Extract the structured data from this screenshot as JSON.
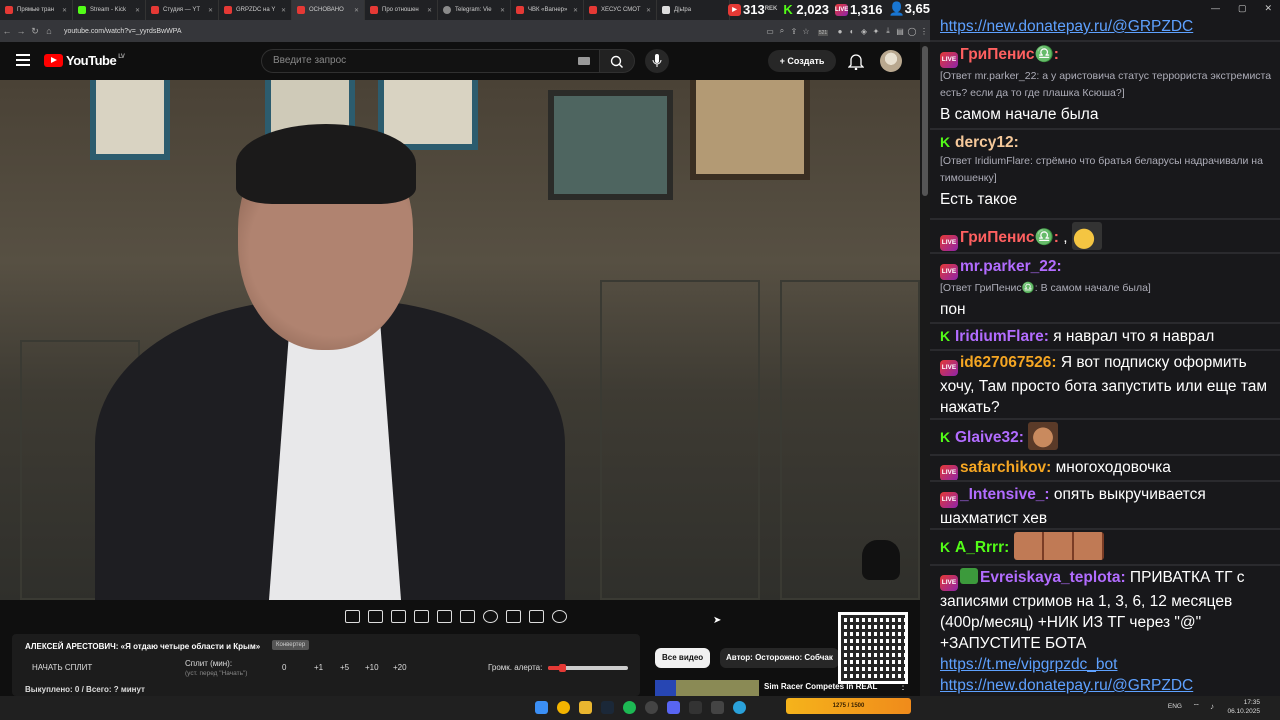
{
  "browser": {
    "tabs": [
      {
        "label": "Прямые тран",
        "color": "#e53935"
      },
      {
        "label": "Stream - Kick",
        "color": "#53fc18"
      },
      {
        "label": "Студия — YT",
        "color": "#e53935"
      },
      {
        "label": "GRPZDC на Y",
        "color": "#e53935"
      },
      {
        "label": "ОСНОВАНО",
        "color": "#e53935"
      },
      {
        "label": "Про отношен",
        "color": "#e53935"
      },
      {
        "label": "Telegram: Vie",
        "color": "#8a8a8a"
      },
      {
        "label": "ЧВК «Вагнер»",
        "color": "#e53935"
      },
      {
        "label": "ХЕСУС СМОТ",
        "color": "#e53935"
      },
      {
        "label": "Д|ьtра",
        "color": "#dddddd"
      }
    ],
    "url": "youtube.com/watch?v=_yyrdsBwWPA",
    "ext_badge": "521"
  },
  "stats": {
    "youtube": "313",
    "kick": "2,023",
    "live": "1,316",
    "viewers": "3,652",
    "partial_label": "REK"
  },
  "youtube": {
    "logo": "YouTube",
    "country": "LV",
    "search_placeholder": "Введите запрос",
    "create_label": "Создать"
  },
  "panel": {
    "title": "АЛЕКСЕЙ АРЕСТОВИЧ: «Я отдаю четыре области и Крым»",
    "tag": "Конвертер",
    "start_label": "НАЧАТЬ СПЛИТ",
    "split_label": "Сплит (мин):",
    "split_hint": "(уст. перед \"Начать\")",
    "split_value": "0",
    "increments": [
      "+1",
      "+5",
      "+10",
      "+20"
    ],
    "volume_label": "Громк. алерта:",
    "volume_level": 0.17,
    "bought": "Выкуплено: 0 / Всего: ? минут"
  },
  "recommendations": {
    "chip_all": "Все видео",
    "chip_author": "Автор: Осторожно: Собчак",
    "item_title": "Sim Racer Competes In REAL"
  },
  "chat": {
    "top_link": "https://new.donatepay.ru/@GRPZDC",
    "messages": [
      {
        "badge": "live",
        "user": "ГриПенис♎:",
        "user_color": "#ff6060",
        "reply": "[Ответ mr.parker_22: а у аристовича статус террориста экстремиста есть? если да то где плашка Ксюша?]",
        "text": "В самом начале была"
      },
      {
        "badge": "k",
        "user": "dercy12:",
        "user_color": "#f5c89a",
        "reply": "[Ответ IridiumFlare: стрёмно что братья беларусы надрачивали на тимошенку]",
        "text": "Есть такое"
      },
      {
        "badge": "live",
        "user": "ГриПенис♎:",
        "user_color": "#ff6060",
        "reply": "",
        "text": ","
      },
      {
        "badge": "live",
        "user": "mr.parker_22:",
        "user_color": "#b26cff",
        "reply": "[Ответ ГриПенис♎: В самом начале была]",
        "text": "пон"
      },
      {
        "badge": "k",
        "user": "IridiumFlare:",
        "user_color": "#b26cff",
        "reply": "",
        "text": "я наврал что я наврал"
      },
      {
        "badge": "live",
        "user": "id627067526:",
        "user_color": "#f5a623",
        "reply": "",
        "text": "Я вот подписку оформить хочу, Там просто бота запустить или еще там нажать?"
      },
      {
        "badge": "k",
        "user": "Glaive32:",
        "user_color": "#b26cff",
        "reply": "",
        "text": ""
      },
      {
        "badge": "live",
        "user": "safarchikov:",
        "user_color": "#f5a623",
        "reply": "",
        "text": "многоходовочка"
      },
      {
        "badge": "live",
        "user": "_Intensive_:",
        "user_color": "#b26cff",
        "reply": "",
        "text": "опять выкручивается шахматист хев"
      },
      {
        "badge": "k",
        "user": "A_Rrrr:",
        "user_color": "#53fc18",
        "reply": "",
        "text": ""
      },
      {
        "badge": "live",
        "user": "Evreiskaya_teplota:",
        "user_color": "#b26cff",
        "reply": "",
        "text": "ПРИВАТКА ТГ с записями стримов на 1, 3, 6, 12 месяцев (400р/месяц) +НИК ИЗ ТГ через \"@\" +ЗАПУСТИТЕ БОТА"
      }
    ],
    "link1": "https://t.me/vipgrpzdc_bot",
    "link2": "https://new.donatepay.ru/@GRPZDC"
  },
  "taskbar": {
    "meme": "1275 / 1500",
    "lang": "ENG",
    "time": "17:35",
    "date": "06.10.2025"
  },
  "colors": {
    "kick": "#53fc18",
    "youtube_red": "#ff0000",
    "link": "#5ea1ff"
  }
}
